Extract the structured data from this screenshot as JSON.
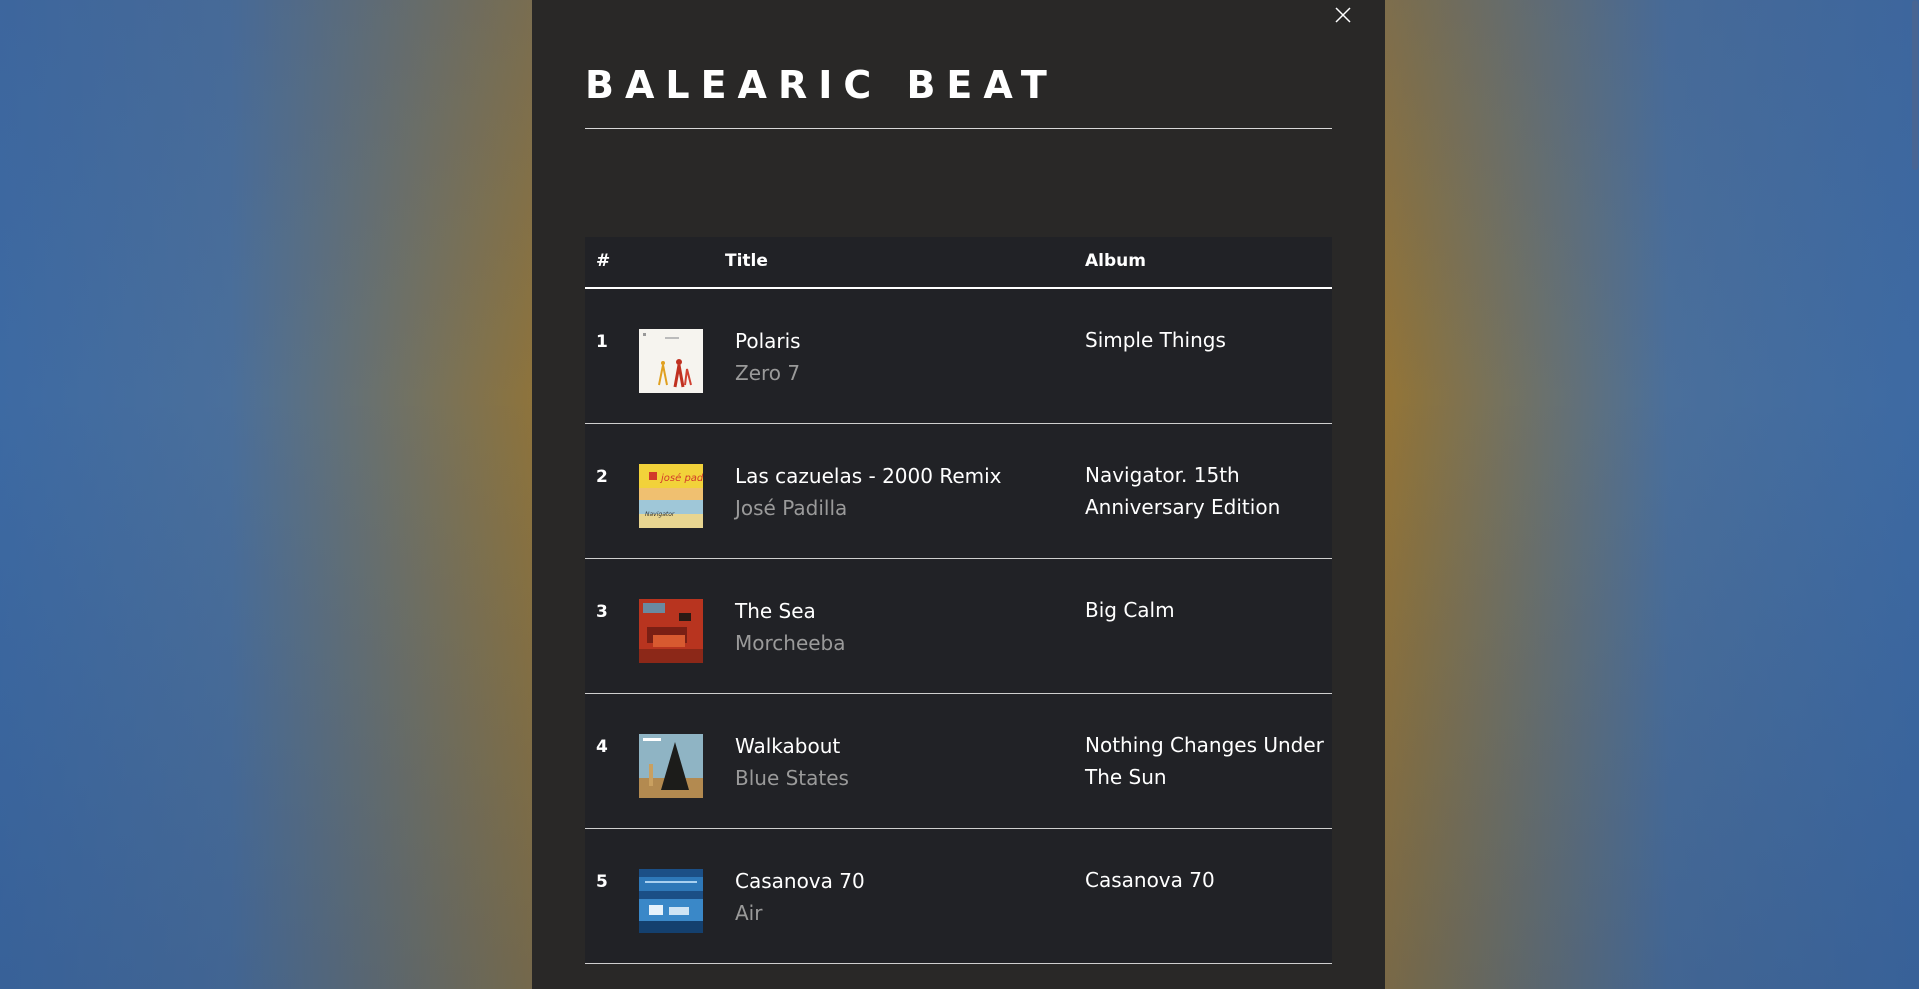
{
  "playlist": {
    "title": "BALEARIC BEAT"
  },
  "table": {
    "headers": {
      "number": "#",
      "title": "Title",
      "album": "Album"
    },
    "tracks": [
      {
        "number": "1",
        "song": "Polaris",
        "artist": "Zero 7",
        "album": "Simple Things"
      },
      {
        "number": "2",
        "song": "Las cazuelas - 2000 Remix",
        "artist": "José Padilla",
        "album": "Navigator. 15th Anniversary Edition"
      },
      {
        "number": "3",
        "song": "The Sea",
        "artist": "Morcheeba",
        "album": "Big Calm"
      },
      {
        "number": "4",
        "song": "Walkabout",
        "artist": "Blue States",
        "album": "Nothing Changes Under The Sun"
      },
      {
        "number": "5",
        "song": "Casanova 70",
        "artist": "Air",
        "album": "Casanova 70"
      }
    ]
  },
  "icons": {
    "close": "close-icon"
  }
}
